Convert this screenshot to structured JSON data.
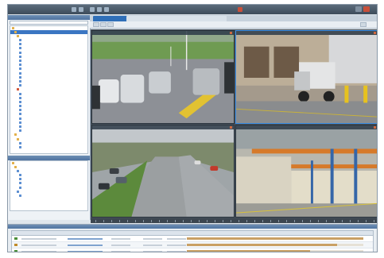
{
  "window": {
    "title": ""
  },
  "tabs": [
    {
      "label": ""
    },
    {
      "label": ""
    },
    {
      "label": ""
    }
  ],
  "left_panel": {
    "header": "",
    "tree_rows": 30,
    "second_header": ""
  },
  "cameras": [
    {
      "title": ""
    },
    {
      "title": ""
    },
    {
      "title": ""
    },
    {
      "title": ""
    }
  ],
  "table": {
    "columns": [
      "",
      "",
      "",
      "",
      "",
      ""
    ],
    "rows": [
      {
        "status": "ok",
        "progress": 1.0
      },
      {
        "status": "warn",
        "progress": 0.85
      },
      {
        "status": "ok",
        "progress": 0.7
      }
    ]
  },
  "colors": {
    "accent": "#2f6fb8",
    "selection": "#3b76c2",
    "progress": "#c9a064",
    "titlebar": "#4a5a6a"
  },
  "icons": [
    "search-icon",
    "folder-icon",
    "camera-icon",
    "close-icon"
  ]
}
